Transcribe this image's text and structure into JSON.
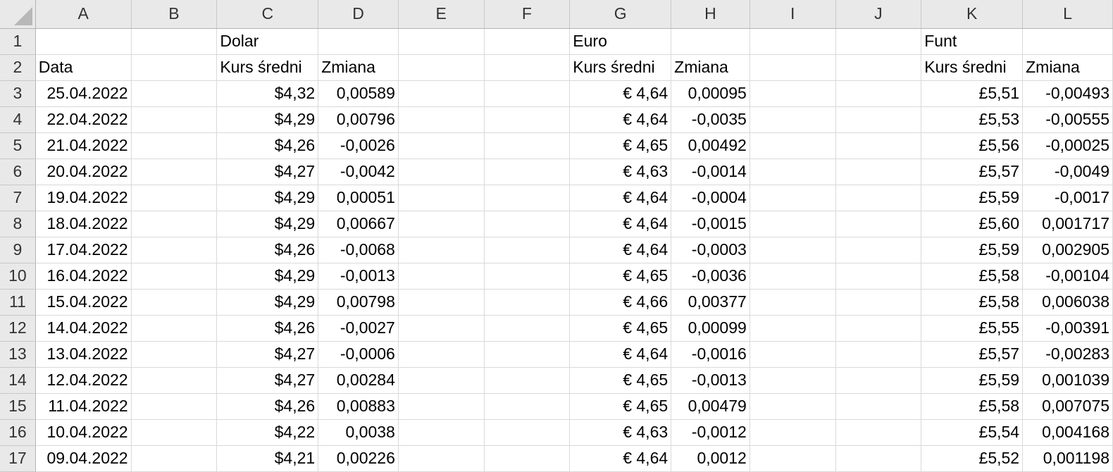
{
  "column_headers": [
    "A",
    "B",
    "C",
    "D",
    "E",
    "F",
    "G",
    "H",
    "I",
    "J",
    "K",
    "L"
  ],
  "rows": [
    {
      "num": "1",
      "cells": [
        "",
        "",
        "Dolar",
        "",
        "",
        "",
        "Euro",
        "",
        "",
        "",
        "Funt",
        ""
      ]
    },
    {
      "num": "2",
      "cells": [
        "Data",
        "",
        "Kurs średni",
        "Zmiana",
        "",
        "",
        "Kurs średni",
        "Zmiana",
        "",
        "",
        "Kurs średni",
        "Zmiana"
      ]
    },
    {
      "num": "3",
      "cells": [
        "25.04.2022",
        "",
        "$4,32",
        "0,00589",
        "",
        "",
        "€ 4,64",
        "0,00095",
        "",
        "",
        "£5,51",
        "-0,00493"
      ]
    },
    {
      "num": "4",
      "cells": [
        "22.04.2022",
        "",
        "$4,29",
        "0,00796",
        "",
        "",
        "€ 4,64",
        "-0,0035",
        "",
        "",
        "£5,53",
        "-0,00555"
      ]
    },
    {
      "num": "5",
      "cells": [
        "21.04.2022",
        "",
        "$4,26",
        "-0,0026",
        "",
        "",
        "€ 4,65",
        "0,00492",
        "",
        "",
        "£5,56",
        "-0,00025"
      ]
    },
    {
      "num": "6",
      "cells": [
        "20.04.2022",
        "",
        "$4,27",
        "-0,0042",
        "",
        "",
        "€ 4,63",
        "-0,0014",
        "",
        "",
        "£5,57",
        "-0,0049"
      ]
    },
    {
      "num": "7",
      "cells": [
        "19.04.2022",
        "",
        "$4,29",
        "0,00051",
        "",
        "",
        "€ 4,64",
        "-0,0004",
        "",
        "",
        "£5,59",
        "-0,0017"
      ]
    },
    {
      "num": "8",
      "cells": [
        "18.04.2022",
        "",
        "$4,29",
        "0,00667",
        "",
        "",
        "€ 4,64",
        "-0,0015",
        "",
        "",
        "£5,60",
        "0,001717"
      ]
    },
    {
      "num": "9",
      "cells": [
        "17.04.2022",
        "",
        "$4,26",
        "-0,0068",
        "",
        "",
        "€ 4,64",
        "-0,0003",
        "",
        "",
        "£5,59",
        "0,002905"
      ]
    },
    {
      "num": "10",
      "cells": [
        "16.04.2022",
        "",
        "$4,29",
        "-0,0013",
        "",
        "",
        "€ 4,65",
        "-0,0036",
        "",
        "",
        "£5,58",
        "-0,00104"
      ]
    },
    {
      "num": "11",
      "cells": [
        "15.04.2022",
        "",
        "$4,29",
        "0,00798",
        "",
        "",
        "€ 4,66",
        "0,00377",
        "",
        "",
        "£5,58",
        "0,006038"
      ]
    },
    {
      "num": "12",
      "cells": [
        "14.04.2022",
        "",
        "$4,26",
        "-0,0027",
        "",
        "",
        "€ 4,65",
        "0,00099",
        "",
        "",
        "£5,55",
        "-0,00391"
      ]
    },
    {
      "num": "13",
      "cells": [
        "13.04.2022",
        "",
        "$4,27",
        "-0,0006",
        "",
        "",
        "€ 4,64",
        "-0,0016",
        "",
        "",
        "£5,57",
        "-0,00283"
      ]
    },
    {
      "num": "14",
      "cells": [
        "12.04.2022",
        "",
        "$4,27",
        "0,00284",
        "",
        "",
        "€ 4,65",
        "-0,0013",
        "",
        "",
        "£5,59",
        "0,001039"
      ]
    },
    {
      "num": "15",
      "cells": [
        "11.04.2022",
        "",
        "$4,26",
        "0,00883",
        "",
        "",
        "€ 4,65",
        "0,00479",
        "",
        "",
        "£5,58",
        "0,007075"
      ]
    },
    {
      "num": "16",
      "cells": [
        "10.04.2022",
        "",
        "$4,22",
        "0,0038",
        "",
        "",
        "€ 4,63",
        "-0,0012",
        "",
        "",
        "£5,54",
        "0,004168"
      ]
    },
    {
      "num": "17",
      "cells": [
        "09.04.2022",
        "",
        "$4,21",
        "0,00226",
        "",
        "",
        "€ 4,64",
        "0,0012",
        "",
        "",
        "£5,52",
        "0,001198"
      ]
    }
  ]
}
